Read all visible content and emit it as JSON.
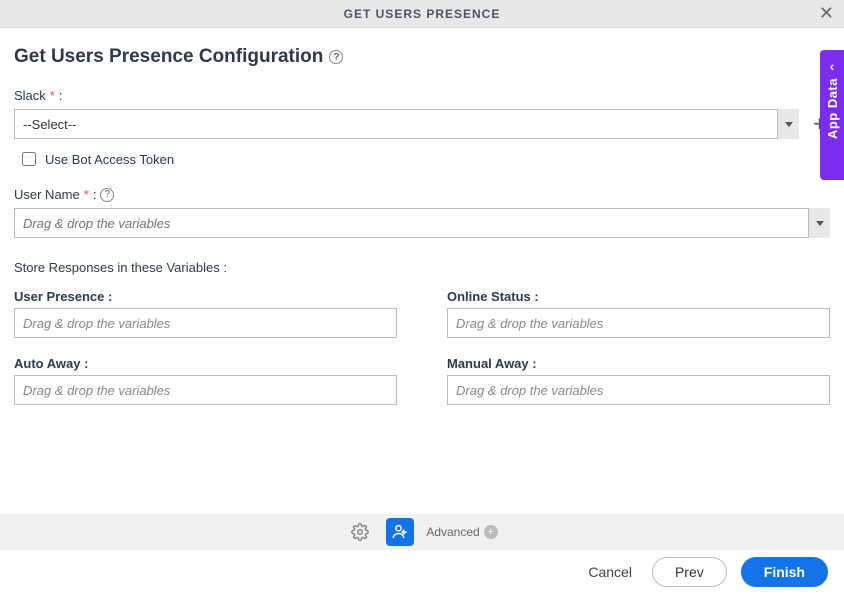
{
  "header": {
    "title": "GET USERS PRESENCE"
  },
  "page": {
    "heading": "Get Users Presence Configuration"
  },
  "slack": {
    "label": "Slack",
    "required": "*",
    "colon": ":",
    "selected": "--Select--"
  },
  "bot_token": {
    "label": "Use Bot Access Token"
  },
  "username": {
    "label": "User Name",
    "required": "*",
    "colon": ":",
    "placeholder": "Drag & drop the variables"
  },
  "store_section": {
    "heading": "Store Responses in these Variables :",
    "placeholder": "Drag & drop the variables",
    "fields": {
      "user_presence": "User Presence :",
      "online_status": "Online Status :",
      "auto_away": "Auto Away :",
      "manual_away": "Manual Away :"
    }
  },
  "side_tab": {
    "label": "App Data"
  },
  "toolbar": {
    "advanced": "Advanced"
  },
  "footer": {
    "cancel": "Cancel",
    "prev": "Prev",
    "finish": "Finish"
  }
}
